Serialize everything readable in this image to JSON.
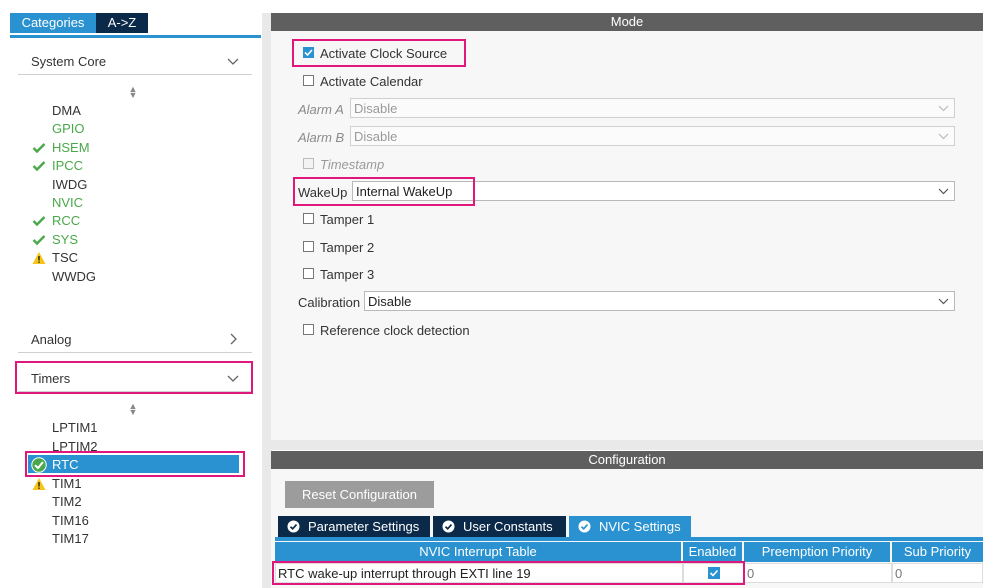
{
  "left_tabs": [
    {
      "label": "Categories",
      "active": false
    },
    {
      "label": "A->Z",
      "active": true
    }
  ],
  "categories": {
    "system_core": {
      "label": "System Core",
      "items": [
        {
          "label": "DMA",
          "state": "plain"
        },
        {
          "label": "GPIO",
          "state": "green"
        },
        {
          "label": "HSEM",
          "state": "check"
        },
        {
          "label": "IPCC",
          "state": "check"
        },
        {
          "label": "IWDG",
          "state": "plain"
        },
        {
          "label": "NVIC",
          "state": "green"
        },
        {
          "label": "RCC",
          "state": "check"
        },
        {
          "label": "SYS",
          "state": "check"
        },
        {
          "label": "TSC",
          "state": "warning"
        },
        {
          "label": "WWDG",
          "state": "plain"
        }
      ]
    },
    "analog": {
      "label": "Analog"
    },
    "timers": {
      "label": "Timers",
      "items": [
        {
          "label": "LPTIM1",
          "state": "plain"
        },
        {
          "label": "LPTIM2",
          "state": "plain"
        },
        {
          "label": "RTC",
          "state": "selected"
        },
        {
          "label": "TIM1",
          "state": "warning"
        },
        {
          "label": "TIM2",
          "state": "plain"
        },
        {
          "label": "TIM16",
          "state": "plain"
        },
        {
          "label": "TIM17",
          "state": "plain"
        }
      ]
    }
  },
  "mode": {
    "title": "Mode",
    "activate_clock_source": {
      "label": "Activate Clock Source",
      "checked": true
    },
    "activate_calendar": {
      "label": "Activate Calendar",
      "checked": false
    },
    "alarm_a": {
      "label": "Alarm A",
      "value": "Disable"
    },
    "alarm_b": {
      "label": "Alarm B",
      "value": "Disable"
    },
    "timestamp": {
      "label": "Timestamp",
      "checked": false
    },
    "wakeup": {
      "label": "WakeUp",
      "value": "Internal WakeUp"
    },
    "tamper1": {
      "label": "Tamper 1",
      "checked": false
    },
    "tamper2": {
      "label": "Tamper 2",
      "checked": false
    },
    "tamper3": {
      "label": "Tamper 3",
      "checked": false
    },
    "calibration": {
      "label": "Calibration",
      "value": "Disable"
    },
    "reference_clock": {
      "label": "Reference clock detection",
      "checked": false
    }
  },
  "configuration": {
    "title": "Configuration",
    "reset_label": "Reset Configuration",
    "tabs": [
      "Parameter Settings",
      "User Constants",
      "NVIC Settings"
    ],
    "active_tab": "NVIC Settings",
    "table": {
      "headers": [
        "NVIC Interrupt Table",
        "Enabled",
        "Preemption Priority",
        "Sub Priority"
      ],
      "rows": [
        {
          "name": "RTC wake-up interrupt through EXTI line 19",
          "enabled": true,
          "preemption": "0",
          "sub": "0"
        }
      ]
    }
  },
  "colors": {
    "accent": "#2a92d0",
    "header_bg": "#5f5f5f",
    "highlight": "#e0187b",
    "ok_green": "#4aa84a",
    "warning": "#f5c518",
    "dark_tab": "#0b2a4a"
  }
}
